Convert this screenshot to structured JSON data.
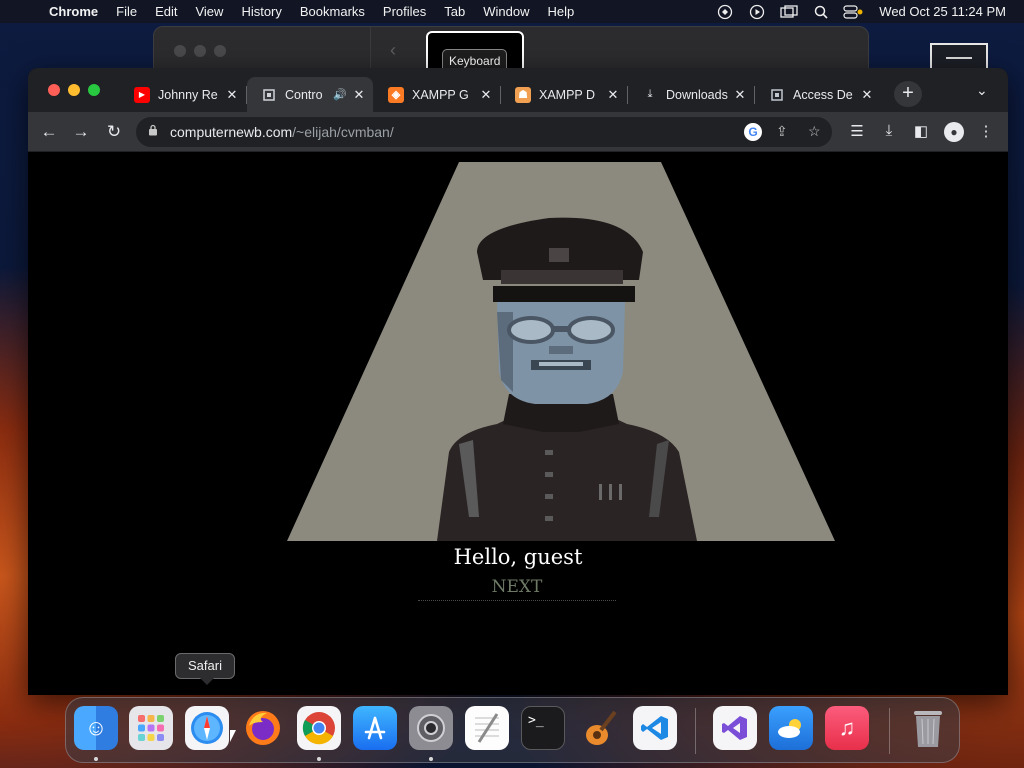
{
  "menubar": {
    "app": "Chrome",
    "items": [
      "File",
      "Edit",
      "View",
      "History",
      "Bookmarks",
      "Profiles",
      "Tab",
      "Window",
      "Help"
    ],
    "clock": "Wed Oct 25  11:24 PM"
  },
  "keyboard_tooltip": "Keyboard",
  "browser": {
    "tabs": [
      {
        "title": "Johnny Re",
        "favicon": "youtube-icon"
      },
      {
        "title": "Contro",
        "favicon": "wordpress-icon",
        "active": true
      },
      {
        "title": "XAMPP G",
        "favicon": "xampp-icon"
      },
      {
        "title": "XAMPP D",
        "favicon": "xampp-dashboard-icon"
      },
      {
        "title": "Downloads",
        "favicon": "download-icon"
      },
      {
        "title": "Access De",
        "favicon": "wordpress-icon"
      }
    ],
    "url_host": "computernewb.com",
    "url_path": "/~elijah/cvmban/"
  },
  "page": {
    "greeting": "Hello, guest",
    "next_label": "NEXT",
    "colors": {
      "spotlight": "#8c8a7e",
      "background": "#000000",
      "skin": "#7e93a6",
      "uniform": "#2b2424"
    }
  },
  "dock_tooltip": "Safari",
  "dock": {
    "apps": [
      "Finder",
      "Launchpad",
      "Safari",
      "Firefox",
      "Google Chrome",
      "App Store",
      "System Settings",
      "TextEdit",
      "Terminal",
      "GarageBand",
      "Visual Studio Code",
      "Visual Studio",
      "Weather",
      "Music",
      "Trash"
    ]
  }
}
